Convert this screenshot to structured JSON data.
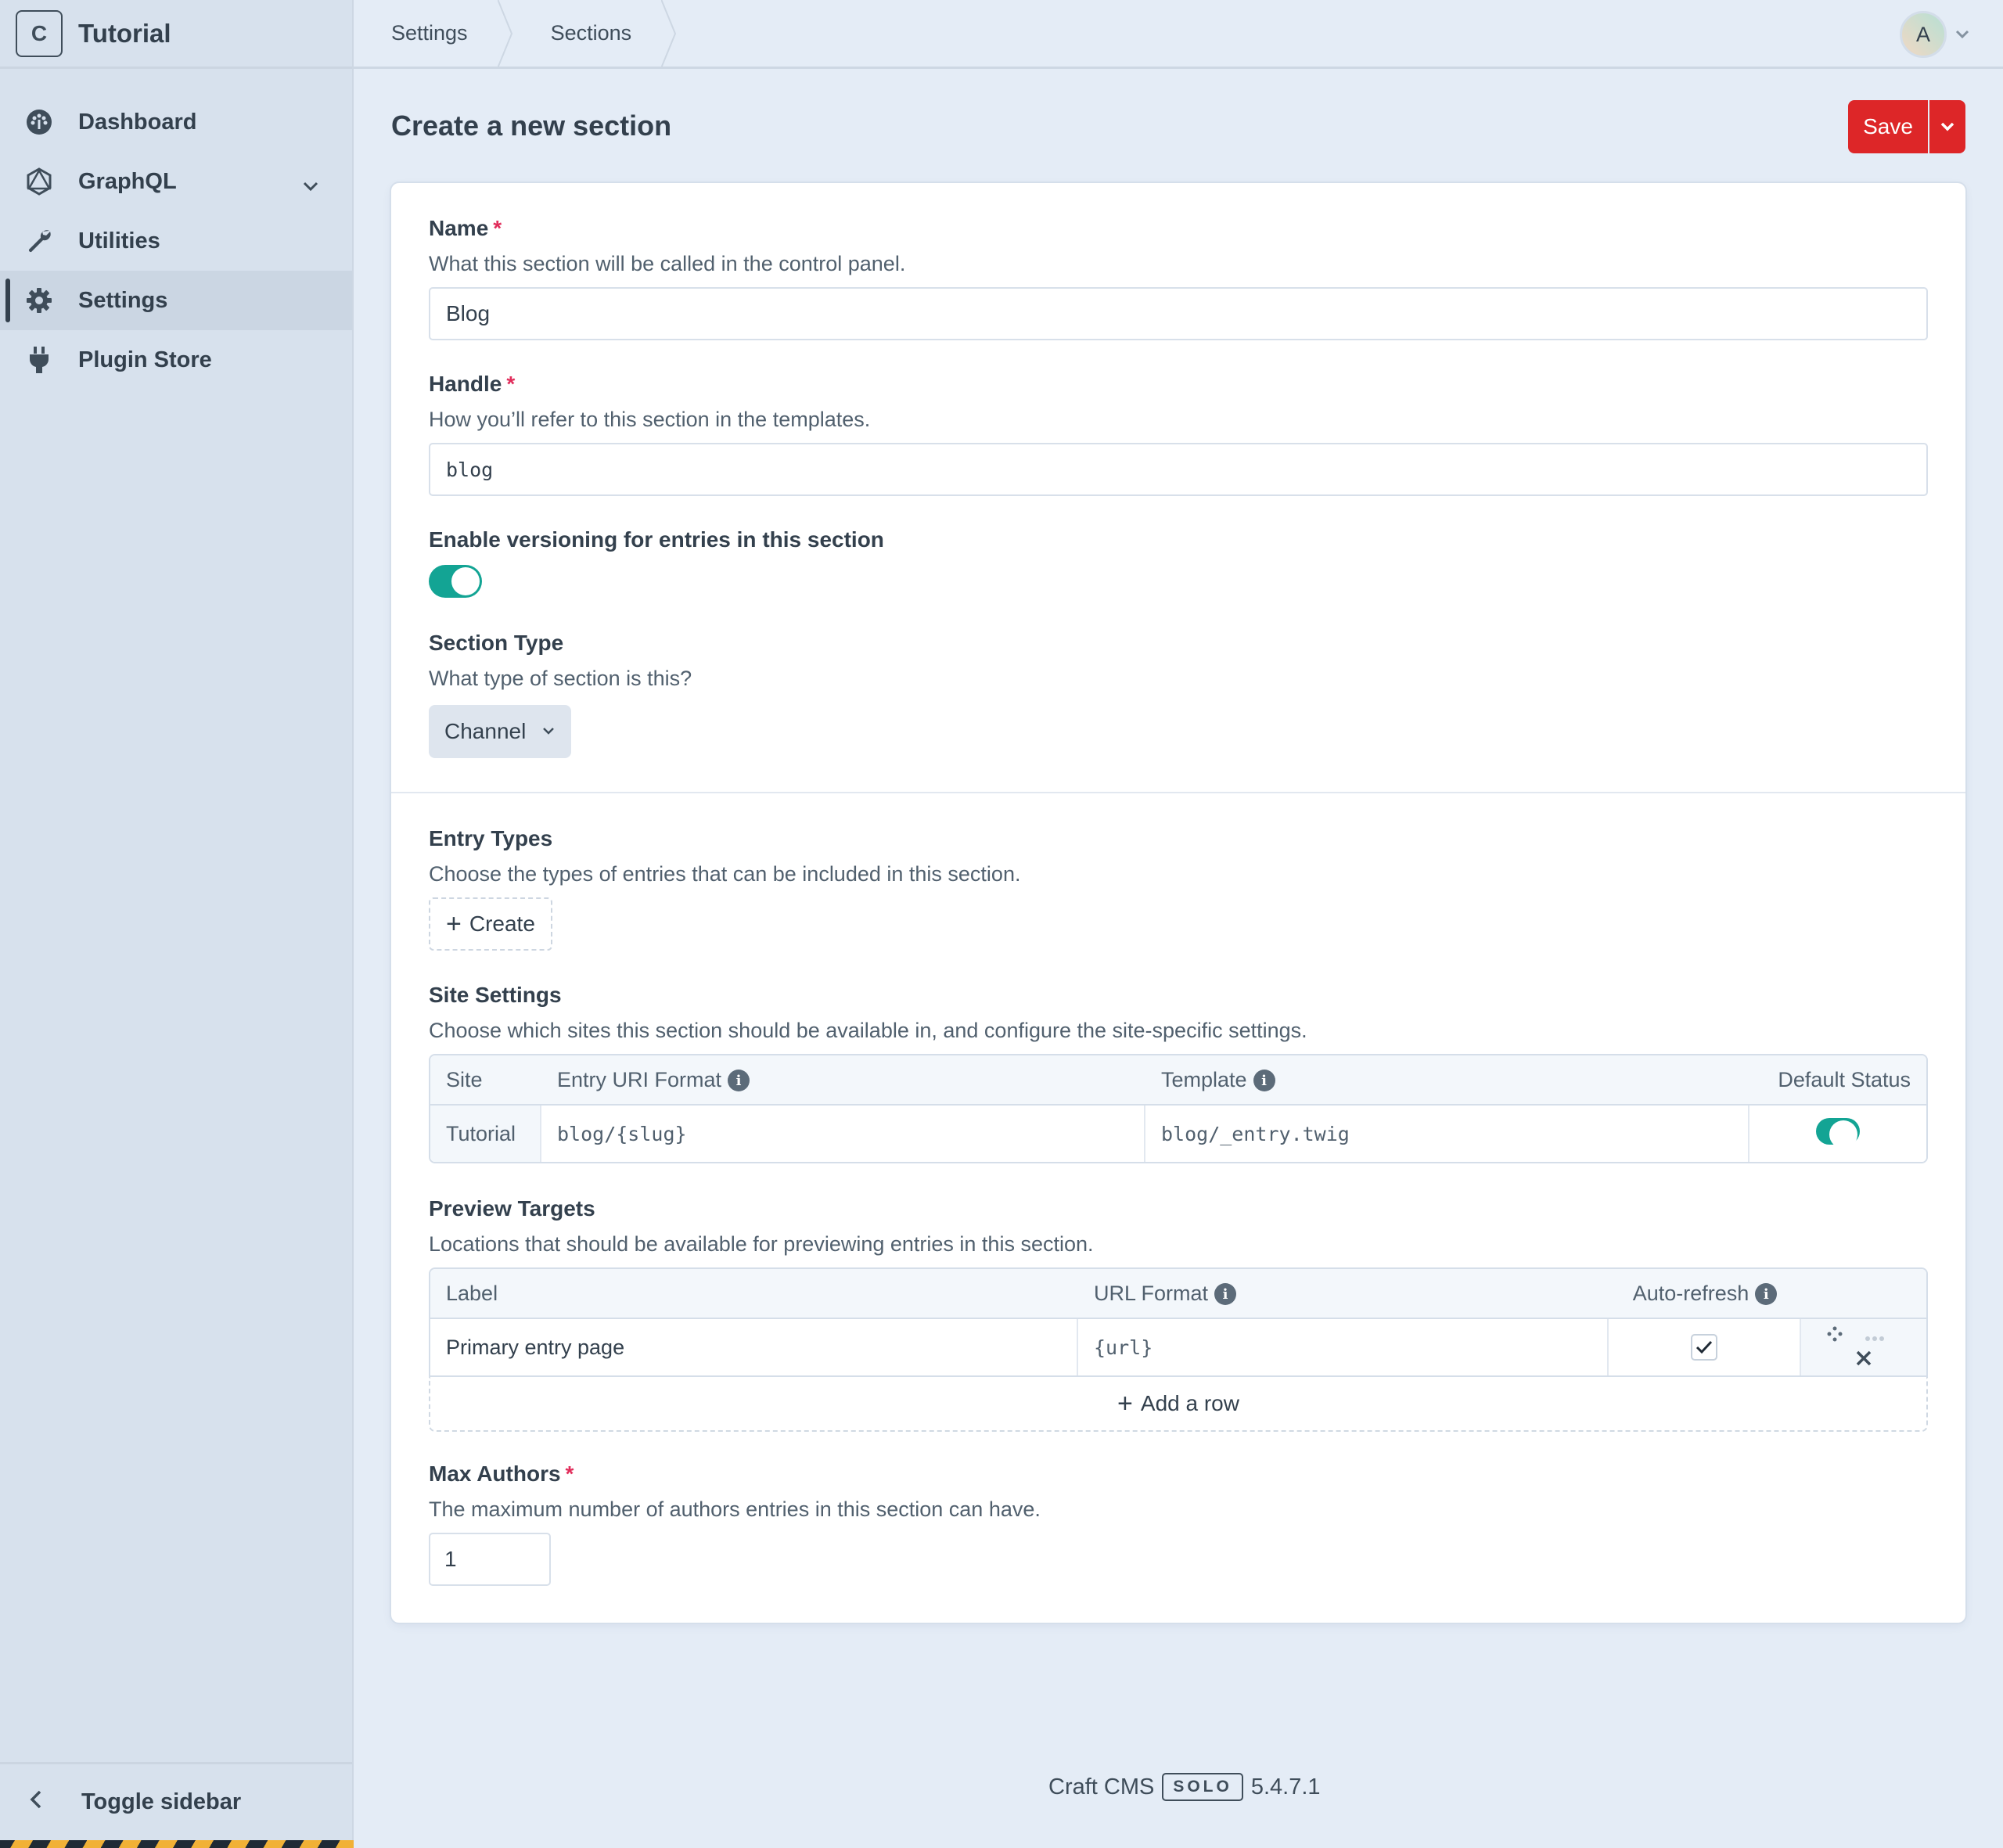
{
  "sidebar": {
    "logo_letter": "C",
    "site_name": "Tutorial",
    "items": [
      {
        "label": "Dashboard",
        "icon": "gauge-icon"
      },
      {
        "label": "GraphQL",
        "icon": "graphql-icon",
        "has_submenu": true
      },
      {
        "label": "Utilities",
        "icon": "wrench-icon"
      },
      {
        "label": "Settings",
        "icon": "gear-icon",
        "active": true
      },
      {
        "label": "Plugin Store",
        "icon": "plug-icon"
      }
    ],
    "toggle_label": "Toggle sidebar"
  },
  "breadcrumbs": [
    "Settings",
    "Sections"
  ],
  "user": {
    "avatar_initial": "A"
  },
  "page": {
    "title": "Create a new section",
    "save_label": "Save"
  },
  "form": {
    "name": {
      "label": "Name",
      "required_mark": "*",
      "instructions": "What this section will be called in the control panel.",
      "value": "Blog"
    },
    "handle": {
      "label": "Handle",
      "required_mark": "*",
      "instructions": "How you’ll refer to this section in the templates.",
      "value": "blog"
    },
    "versioning": {
      "label": "Enable versioning for entries in this section",
      "enabled": true
    },
    "section_type": {
      "label": "Section Type",
      "instructions": "What type of section is this?",
      "selected": "Channel"
    },
    "entry_types": {
      "label": "Entry Types",
      "instructions": "Choose the types of entries that can be included in this section.",
      "create_label": "Create"
    },
    "site_settings": {
      "label": "Site Settings",
      "instructions": "Choose which sites this section should be available in, and configure the site-specific settings.",
      "columns": [
        "Site",
        "Entry URI Format",
        "Template",
        "Default Status"
      ],
      "rows": [
        {
          "site": "Tutorial",
          "uri_format": "blog/{slug}",
          "template": "blog/_entry.twig",
          "default_status": true
        }
      ]
    },
    "preview_targets": {
      "label": "Preview Targets",
      "instructions": "Locations that should be available for previewing entries in this section.",
      "columns": [
        "Label",
        "URL Format",
        "Auto-refresh"
      ],
      "rows": [
        {
          "label": "Primary entry page",
          "url_format": "{url}",
          "auto_refresh": true
        }
      ],
      "add_row_label": "Add a row"
    },
    "max_authors": {
      "label": "Max Authors",
      "required_mark": "*",
      "instructions": "The maximum number of authors entries in this section can have.",
      "value": "1"
    }
  },
  "footer": {
    "product": "Craft CMS",
    "edition": "SOLO",
    "version": "5.4.7.1"
  },
  "colors": {
    "accent_red": "#dd2628",
    "toggle_on": "#13a494",
    "required": "#e12d5b"
  }
}
